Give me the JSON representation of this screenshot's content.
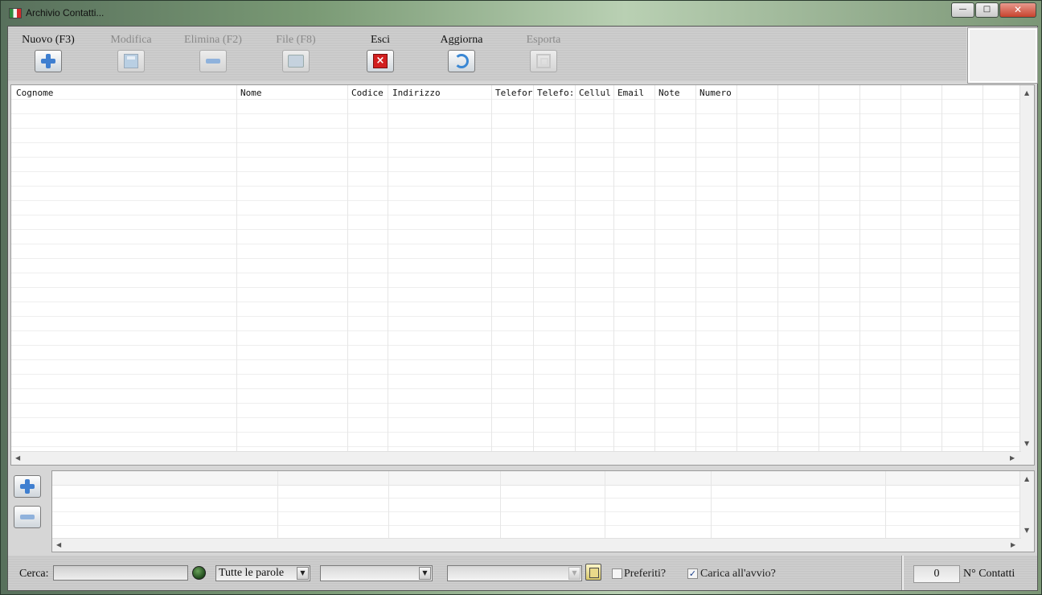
{
  "window": {
    "title": "Archivio Contatti...",
    "controls": {
      "minimize": "—",
      "maximize": "□",
      "close": "✕"
    }
  },
  "toolbar": {
    "buttons": [
      {
        "label": "Nuovo (F3)",
        "icon": "plus-icon",
        "enabled": true
      },
      {
        "label": "Modifica",
        "icon": "edit-icon",
        "enabled": false
      },
      {
        "label": "Elimina (F2)",
        "icon": "minus-icon",
        "enabled": false
      },
      {
        "label": "File (F8)",
        "icon": "file-icon",
        "enabled": false
      },
      {
        "label": "Esci",
        "icon": "close-icon",
        "enabled": true
      },
      {
        "label": "Aggiorna",
        "icon": "refresh-icon",
        "enabled": true
      },
      {
        "label": "Esporta",
        "icon": "export-icon",
        "enabled": false
      }
    ]
  },
  "main_grid": {
    "columns": [
      "Cognome",
      "Nome",
      "Codice",
      "Indirizzo",
      "Telefor",
      "Telefo:",
      "Cellul",
      "Email",
      "Note",
      "Numero"
    ],
    "rows": []
  },
  "sub_grid": {
    "columns": [],
    "rows": []
  },
  "status": {
    "search_label": "Cerca:",
    "search_value": "",
    "search_mode": "Tutte le parole",
    "filter1_value": "",
    "filter2_value": "",
    "preferiti_label": "Preferiti?",
    "preferiti_checked": false,
    "carica_label": "Carica all'avvio?",
    "carica_checked": true,
    "count_value": "0",
    "count_label": "N° Contatti"
  },
  "colors": {
    "close_red": "#d21f1f",
    "accent_blue": "#3f7fd0",
    "led_green": "#2f6b28"
  }
}
